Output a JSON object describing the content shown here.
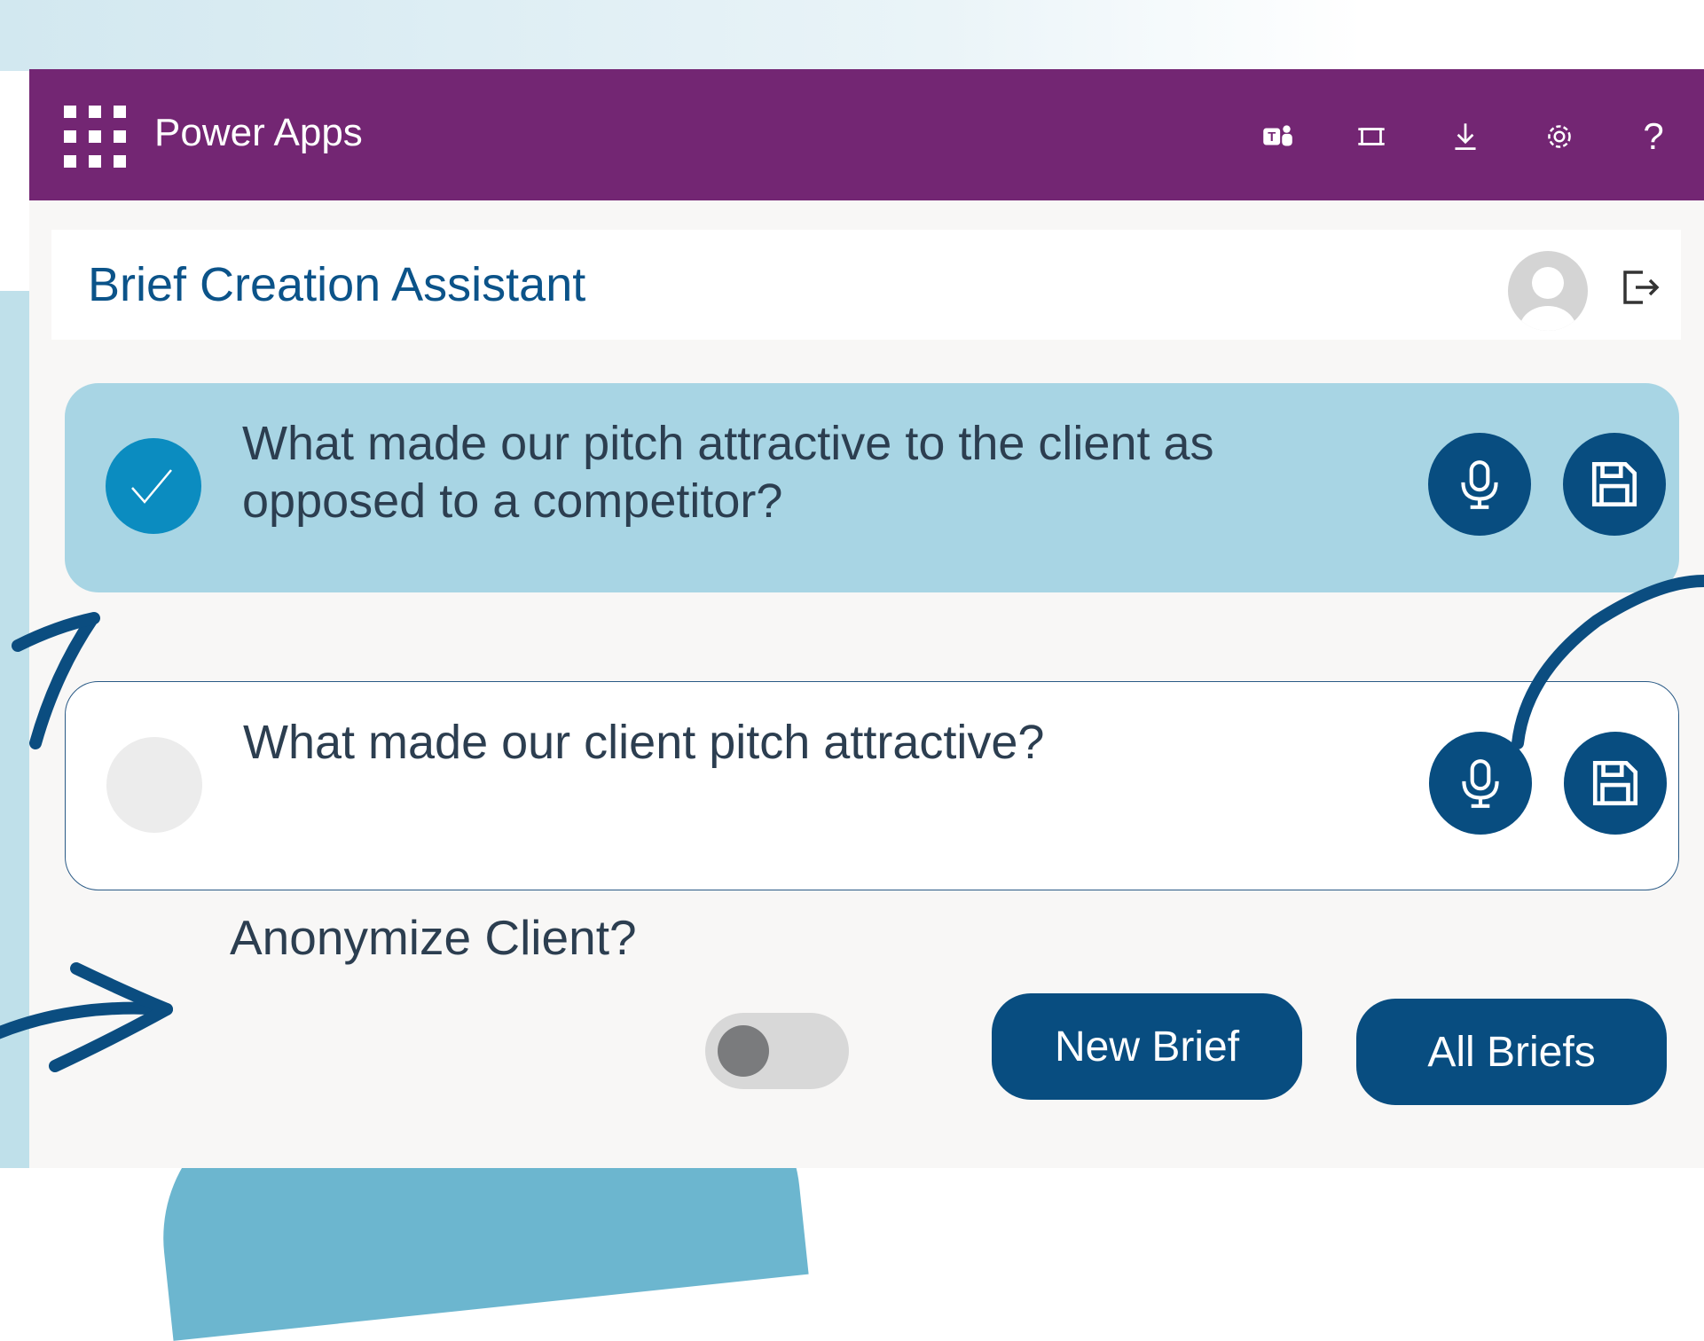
{
  "topbar": {
    "app_name": "Power Apps",
    "background": "#732673",
    "tools": [
      "teams-icon",
      "fit-screen-icon",
      "download-icon",
      "settings-icon",
      "help-icon"
    ],
    "help_glyph": "?"
  },
  "header": {
    "title": "Brief Creation Assistant",
    "title_color": "#0b5389"
  },
  "questions": [
    {
      "text": "What made our pitch attractive to the client as opposed to a competitor?",
      "checked": true,
      "background": "#a8d5e4"
    },
    {
      "text": "What made our client pitch attractive?",
      "checked": false,
      "background": "#ffffff"
    }
  ],
  "anonymize": {
    "label": "Anonymize Client?",
    "enabled": false
  },
  "buttons": {
    "new_brief": "New Brief",
    "all_briefs": "All Briefs"
  },
  "colors": {
    "accent": "#084d80",
    "check_on": "#0b8cc0",
    "deco_blue": "#6cb6cf"
  }
}
